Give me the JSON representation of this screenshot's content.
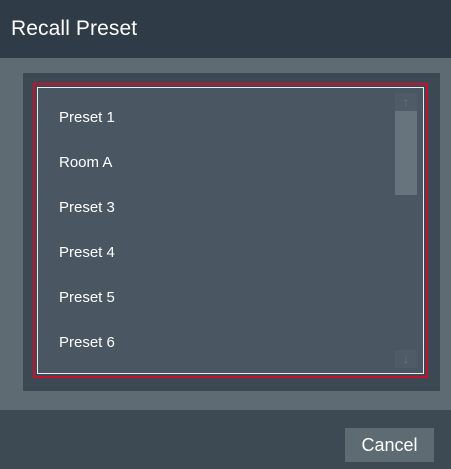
{
  "dialog": {
    "title": "Recall Preset"
  },
  "presets": {
    "items": [
      "Preset 1",
      "Room A",
      "Preset 3",
      "Preset 4",
      "Preset 5",
      "Preset 6"
    ]
  },
  "scrollbar": {
    "up_icon": "arrow-up-icon",
    "down_icon": "arrow-down-icon",
    "up_glyph": "↑",
    "down_glyph": "↓"
  },
  "footer": {
    "cancel_label": "Cancel"
  },
  "colors": {
    "titlebar_bg": "#2f3b46",
    "list_bg": "#4a5662",
    "selection_border": "#c8102e",
    "text": "#ffffff"
  }
}
